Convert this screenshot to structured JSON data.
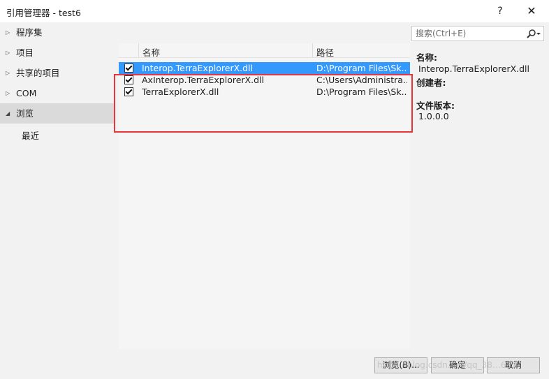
{
  "window": {
    "title": "引用管理器 - test6",
    "help": "?",
    "close": "✕"
  },
  "sidebar": {
    "items": [
      {
        "label": "程序集",
        "arrow": "▷"
      },
      {
        "label": "项目",
        "arrow": "▷"
      },
      {
        "label": "共享的项目",
        "arrow": "▷"
      },
      {
        "label": "COM",
        "arrow": "▷"
      },
      {
        "label": "浏览",
        "arrow": "◢"
      },
      {
        "label": "最近",
        "arrow": ""
      }
    ]
  },
  "search": {
    "placeholder": "搜索(Ctrl+E)"
  },
  "list": {
    "columns": [
      "名称",
      "路径"
    ],
    "rows": [
      {
        "checked": true,
        "name": "Interop.TerraExplorerX.dll",
        "path": "D:\\Program Files\\Sk..."
      },
      {
        "checked": true,
        "name": "AxInterop.TerraExplorerX.dll",
        "path": "C:\\Users\\Administra..."
      },
      {
        "checked": true,
        "name": "TerraExplorerX.dll",
        "path": "D:\\Program Files\\Sk..."
      }
    ]
  },
  "details": {
    "name_label": "名称:",
    "name_value": "Interop.TerraExplorerX.dll",
    "creator_label": "创建者:",
    "version_label": "文件版本:",
    "version_value": "1.0.0.0"
  },
  "buttons": {
    "browse": "浏览(B)...",
    "ok": "确定",
    "cancel": "取消"
  },
  "watermark": "https://blog.csdn.net/qq_38…652",
  "colors": {
    "selection": "#3399ff",
    "highlight_box": "#e8343a",
    "panel": "#f2f2f2"
  }
}
